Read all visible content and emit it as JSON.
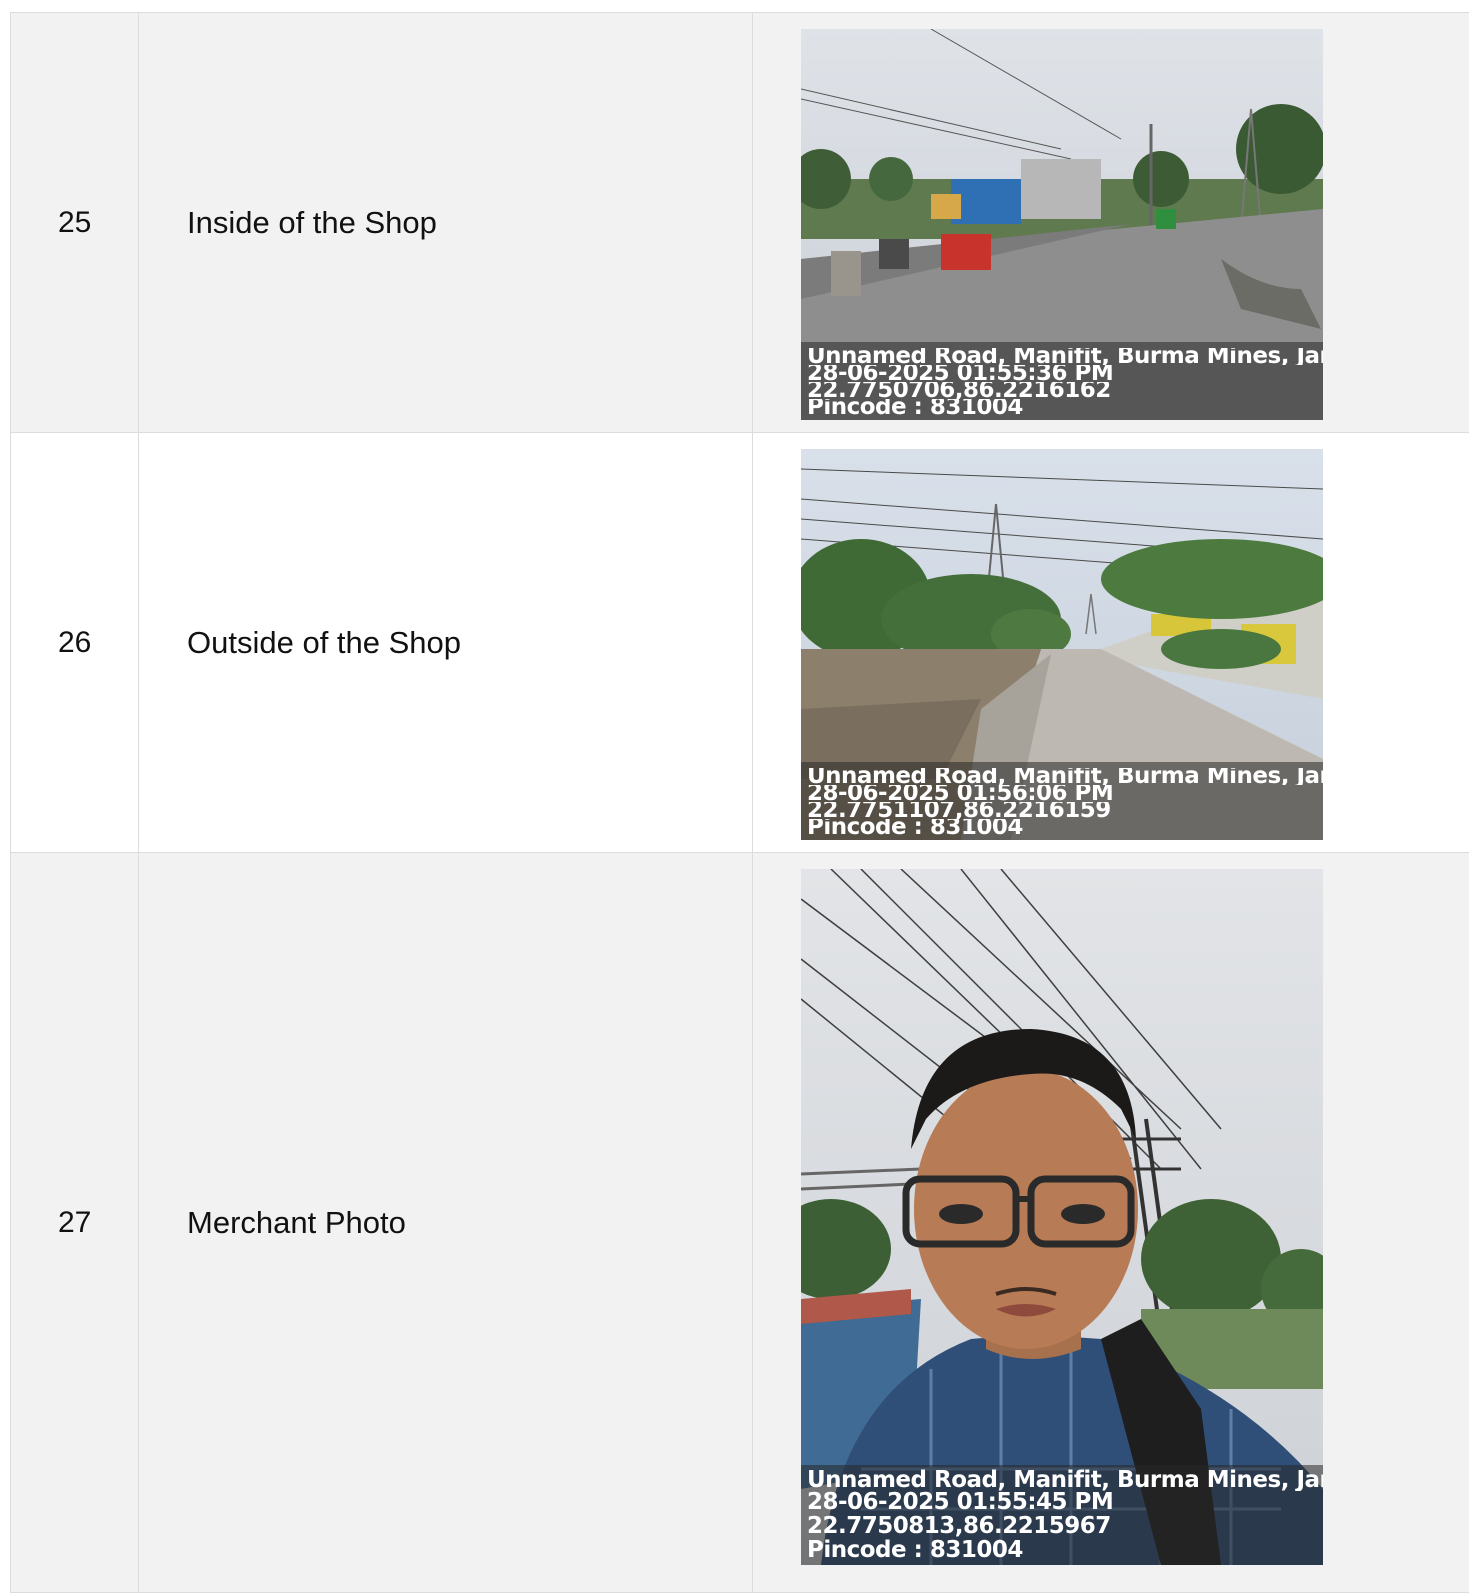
{
  "rows": [
    {
      "number": "25",
      "label": "Inside of the Shop",
      "photo": {
        "address": "Unnamed Road, Manifit, Burma Mines, Jams",
        "datetime": "28-06-2025 01:55:36 PM",
        "coordinates": "22.7750706,86.2216162",
        "pincode": "Pincode : 831004"
      }
    },
    {
      "number": "26",
      "label": "Outside of the Shop",
      "photo": {
        "address": "Unnamed Road, Manifit, Burma Mines, Jams",
        "datetime": "28-06-2025 01:56:06 PM",
        "coordinates": "22.7751107,86.2216159",
        "pincode": "Pincode : 831004"
      }
    },
    {
      "number": "27",
      "label": "Merchant Photo",
      "photo": {
        "address": "Unnamed Road, Manifit, Burma Mines, Jams",
        "datetime": "28-06-2025 01:55:45 PM",
        "coordinates": "22.7750813,86.2215967",
        "pincode": "Pincode : 831004"
      }
    }
  ],
  "colors": {
    "row_shade": "#f2f2f2",
    "border": "#dcdcdc"
  }
}
